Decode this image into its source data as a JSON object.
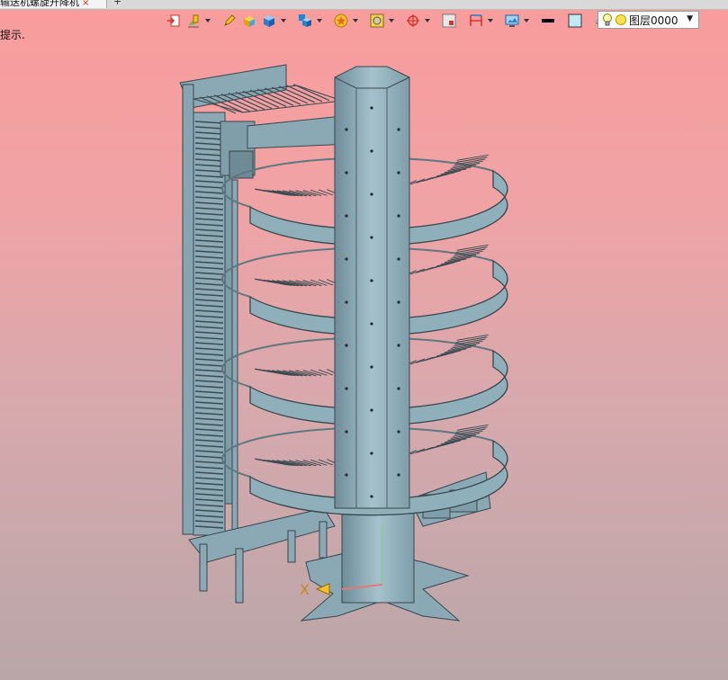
{
  "tab": {
    "title": "输送机螺旋升降机",
    "close": "×",
    "add": "+"
  },
  "hint": {
    "text": "提示."
  },
  "toolbar": {
    "icons": [
      "import-icon",
      "layer-paint-icon",
      "pencil-icon",
      "solid-box-icon",
      "cube-icon",
      "view-cube-icon",
      "star-sphere-icon",
      "render-icon",
      "target-icon",
      "view-frame-icon",
      "dimension-icon",
      "display-icon",
      "line-color-swatch",
      "fill-color-swatch",
      "layer-stack-icon"
    ],
    "colors": {
      "line": "#000000",
      "fill": "#bfe9f7",
      "accent_red": "#d9342b",
      "accent_blue": "#2f7fd0",
      "accent_yellow": "#f6c12c"
    }
  },
  "layer": {
    "label": "图层0000"
  },
  "axis": {
    "x_label": "X"
  },
  "model": {
    "color": "#8aa9b5",
    "edge": "#38474d"
  }
}
